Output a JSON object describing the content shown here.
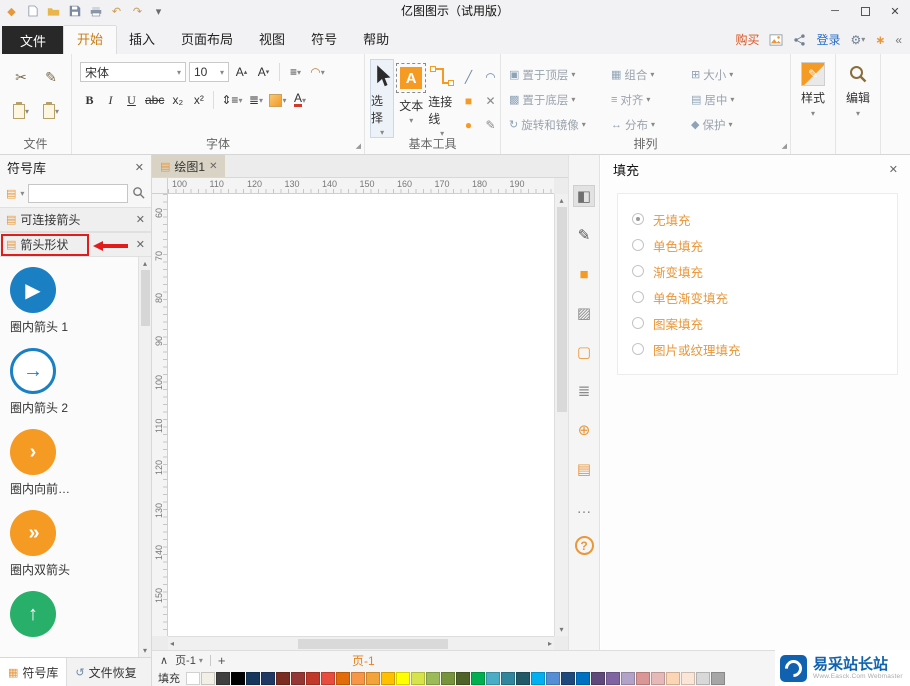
{
  "titlebar": {
    "title": "亿图图示（试用版）"
  },
  "tabrow": {
    "file": "文件",
    "tabs": [
      {
        "label": "开始",
        "active": true
      },
      {
        "label": "插入",
        "active": false
      },
      {
        "label": "页面布局",
        "active": false
      },
      {
        "label": "视图",
        "active": false
      },
      {
        "label": "符号",
        "active": false
      },
      {
        "label": "帮助",
        "active": false
      }
    ],
    "buy": "购买",
    "login": "登录"
  },
  "ribbon": {
    "file_group": {
      "label": "文件"
    },
    "font_group": {
      "label": "字体",
      "font_name": "宋体",
      "font_size": "10",
      "bold": "B",
      "italic": "I",
      "underline": "U",
      "strike": "abc",
      "subscript": "x₂",
      "superscript": "x²"
    },
    "tools_group": {
      "label": "基本工具",
      "select": "选择",
      "text": "文本",
      "connector": "连接线",
      "text_glyph": "A"
    },
    "arrange_group": {
      "label": "排列",
      "items": [
        "置于顶层",
        "组合",
        "大小",
        "置于底层",
        "对齐",
        "居中",
        "旋转和镜像",
        "分布",
        "保护"
      ],
      "icons": [
        "▣",
        "▦",
        "⊞",
        "▩",
        "≡",
        "▤",
        "↻",
        "↔",
        "◆"
      ]
    },
    "style_group": {
      "label": "样式"
    },
    "edit_group": {
      "label": "编辑"
    }
  },
  "left_panel": {
    "title": "符号库",
    "sections": [
      {
        "label": "可连接箭头",
        "highlighted": false
      },
      {
        "label": "箭头形状",
        "highlighted": true
      }
    ],
    "symbols": [
      {
        "label": "圈内箭头 1",
        "kind": "blue-solid",
        "glyph": "▶"
      },
      {
        "label": "圈内箭头 2",
        "kind": "blue-outline",
        "glyph": "→"
      },
      {
        "label": "圈内向前…",
        "kind": "orange-solid",
        "glyph": "›"
      },
      {
        "label": "圈内双箭头",
        "kind": "orange-double",
        "glyph": "»"
      },
      {
        "label": "",
        "kind": "green-up",
        "glyph": "↑"
      }
    ],
    "bottom_tabs": [
      "符号库",
      "文件恢复"
    ]
  },
  "canvas": {
    "tab_label": "绘图1",
    "ruler_h": [
      "100",
      "110",
      "120",
      "130",
      "140",
      "150",
      "160",
      "170",
      "180",
      "190"
    ],
    "ruler_v": [
      "60",
      "70",
      "80",
      "90",
      "100",
      "110",
      "120",
      "130",
      "140",
      "150"
    ]
  },
  "side_toolbar": {
    "icons": [
      {
        "name": "fill-tool",
        "glyph": "◧",
        "active": true,
        "color": "#6f6f6f"
      },
      {
        "name": "line-style-tool",
        "glyph": "✎",
        "active": false,
        "color": "#555555"
      },
      {
        "name": "quick-color-tool",
        "glyph": "■",
        "active": false,
        "color": "#f59a23"
      },
      {
        "name": "picture-tool",
        "glyph": "▨",
        "active": false,
        "color": "#8a8a8a"
      },
      {
        "name": "background-tool",
        "glyph": "▢",
        "active": false,
        "color": "#e8973a"
      },
      {
        "name": "page-list-tool",
        "glyph": "≣",
        "active": false,
        "color": "#8a8a8a"
      },
      {
        "name": "hyperlink-tool",
        "glyph": "⊕",
        "active": false,
        "color": "#e8973a"
      },
      {
        "name": "note-tool",
        "glyph": "▤",
        "active": false,
        "color": "#e8973a"
      },
      {
        "name": "comment-tool",
        "glyph": "…",
        "active": false,
        "color": "#8a8a8a"
      },
      {
        "name": "help-tool",
        "glyph": "?",
        "active": false,
        "circle": true
      }
    ]
  },
  "right_panel": {
    "title": "填充",
    "options": [
      {
        "label": "无填充",
        "selected": true
      },
      {
        "label": "单色填充",
        "selected": false
      },
      {
        "label": "渐变填充",
        "selected": false
      },
      {
        "label": "单色渐变填充",
        "selected": false
      },
      {
        "label": "图案填充",
        "selected": false
      },
      {
        "label": "图片或纹理填充",
        "selected": false
      }
    ]
  },
  "status_bar": {
    "page_nav": "页-1",
    "active_page": "页-1",
    "fill_label": "填充",
    "palette": [
      "#ffffff",
      "#f2f0e6",
      "#3f3f3f",
      "#000000",
      "#16365c",
      "#1f3864",
      "#7b2c20",
      "#953734",
      "#c0392b",
      "#e74c3c",
      "#e36c0a",
      "#f79646",
      "#f2a33a",
      "#ffc000",
      "#ffff00",
      "#d7e34a",
      "#9bbb59",
      "#77933c",
      "#4f6228",
      "#00b050",
      "#4bacc6",
      "#31859c",
      "#215968",
      "#00b0f0",
      "#558ed5",
      "#1f497d",
      "#0070c0",
      "#604a7b",
      "#8064a2",
      "#b2a2c7",
      "#d99694",
      "#e6b9b8",
      "#fcd5b5",
      "#fbe5d6",
      "#d8d8d8",
      "#a6a6a6"
    ]
  },
  "watermark": {
    "text": "易采站长站",
    "subtext": "Www.Easck.Com Webmaster"
  },
  "colors": {
    "accent": "#e8973a",
    "buy": "#d9531e",
    "login": "#2a6fc9",
    "annotation": "#e21b1b",
    "symbol_blue": "#1a7fc3",
    "symbol_orange": "#f59a23",
    "symbol_green": "#28b06a"
  },
  "icons": {
    "caret": "▾",
    "tri_up": "▴",
    "tri_down": "▾",
    "tri_left": "◂",
    "tri_right": "▸",
    "close": "✕",
    "minimize": "─",
    "scissors": "✂",
    "brush": "✎",
    "undo": "↶",
    "redo": "↷",
    "gear": "⚙",
    "star": "∗",
    "collapse": "«",
    "align": "≡",
    "arc": "◠",
    "updown": "⇕",
    "bullets": "≣",
    "a_letter": "A",
    "line": "╱",
    "curve": "◠",
    "rect": "■",
    "cross": "✕",
    "ellipse": "●",
    "pen": "✎",
    "doc": "▤",
    "layers": "▤",
    "section_book": "▤",
    "chevron_up": "∧",
    "plus": "+",
    "launcher": "◢",
    "lp_tab_symbols": "▦",
    "lp_tab_recover": "↺"
  }
}
